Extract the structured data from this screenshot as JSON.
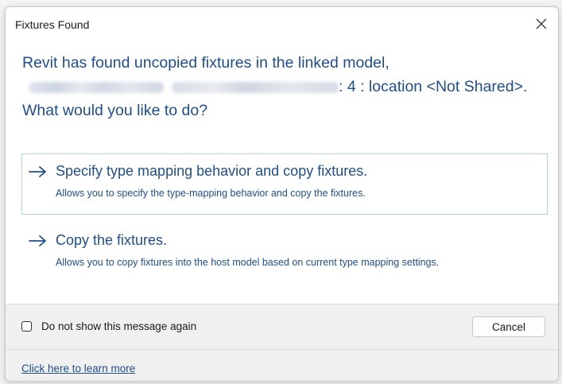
{
  "dialog": {
    "title": "Fixtures Found",
    "close_icon": "close-icon"
  },
  "instruction": {
    "line1": "Revit has found uncopied fixtures in the linked model,",
    "line2_suffix": ": 4 : location <Not Shared>.",
    "line3": "What would you like to do?"
  },
  "options": [
    {
      "icon": "arrow-right-icon",
      "title": "Specify type mapping behavior and copy fixtures.",
      "description": "Allows you to specify the type-mapping behavior and copy the fixtures."
    },
    {
      "icon": "arrow-right-icon",
      "title": "Copy the fixtures.",
      "description": "Allows you to copy fixtures into the host model based on current type mapping settings."
    }
  ],
  "footer": {
    "checkbox_label": "Do not show this message again",
    "checkbox_checked": false,
    "cancel_label": "Cancel",
    "learn_more_link": "Click here to learn more"
  },
  "colors": {
    "accent_text": "#1f4e8c",
    "option_border": "#b7d3ea",
    "footer_bg": "#f0f0f0"
  }
}
